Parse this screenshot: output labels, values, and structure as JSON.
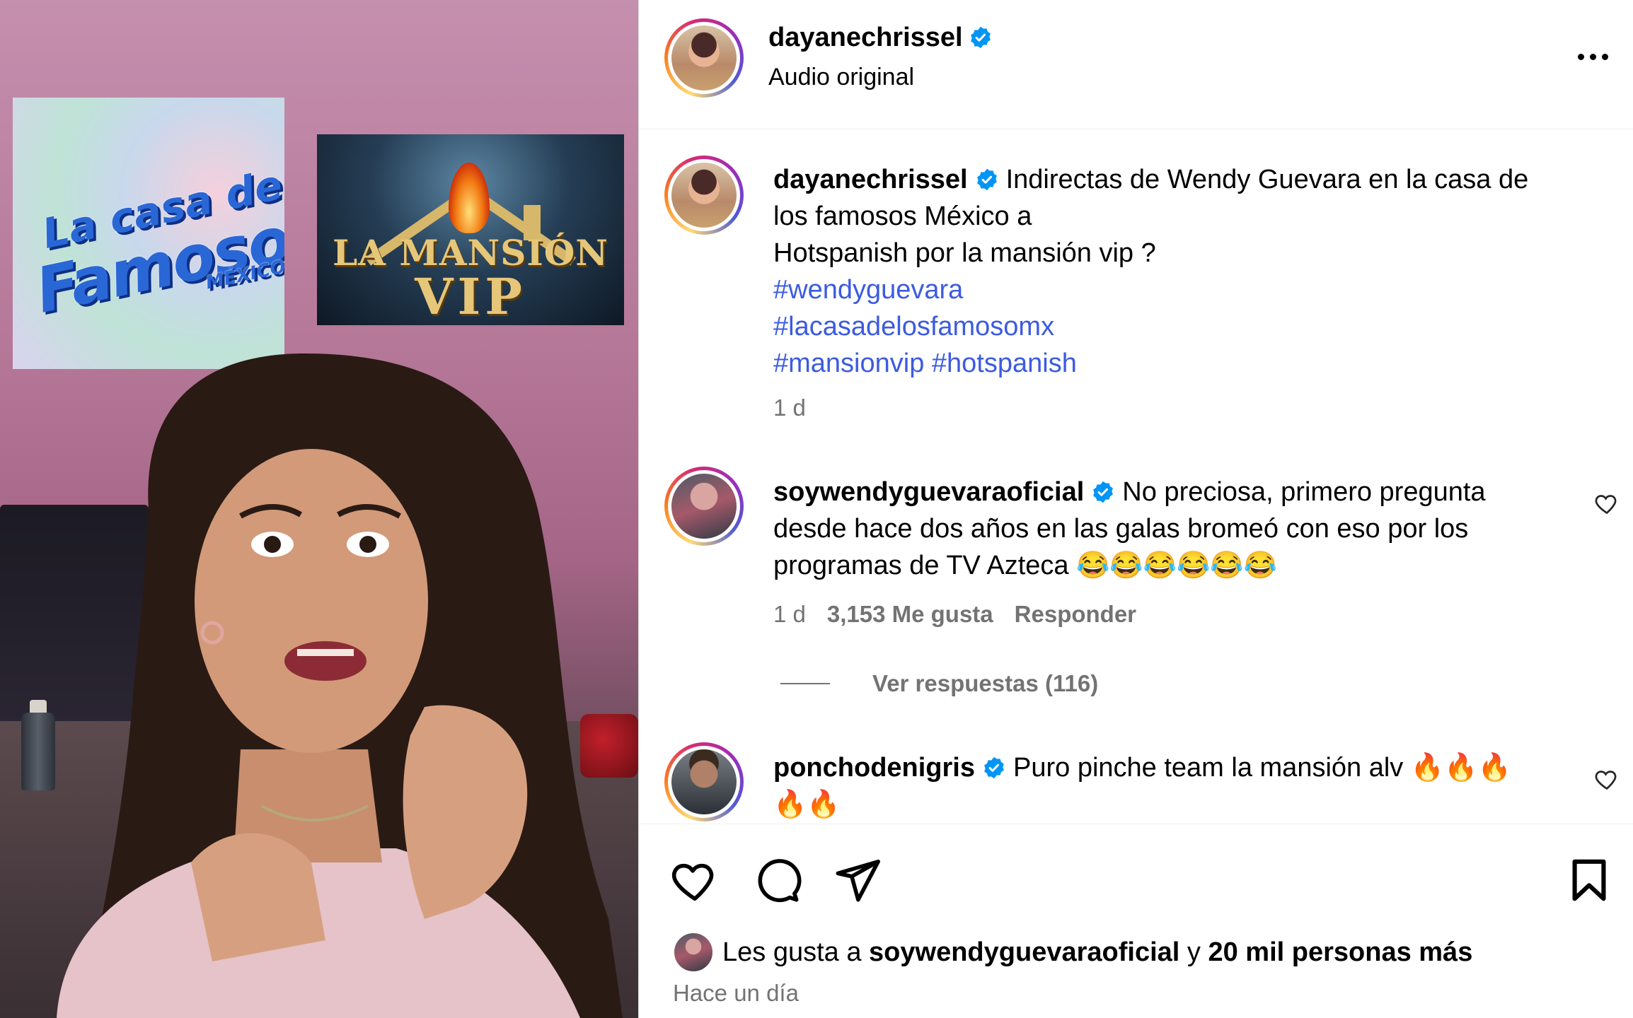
{
  "post": {
    "author": "dayanechrissel",
    "audio": "Audio original"
  },
  "caption": {
    "author": "dayanechrissel",
    "text_line1": "Indirectas de Wendy Guevara en la casa de",
    "text_line2": "los famosos México a",
    "text_line3": "Hotspanish por la mansión vip ?",
    "hashtags": [
      "#wendyguevara",
      "#lacasadelosfamosomx",
      "#mansionvip",
      "#hotspanish"
    ],
    "time": "1 d"
  },
  "comments": [
    {
      "author": "soywendyguevaraoficial",
      "line1": "No preciosa, primero pregunta",
      "line2": "desde hace dos años en las galas bromeó con eso por los",
      "line3": "programas de TV Azteca 😂😂😂😂😂😂",
      "time": "1 d",
      "likes": "3,153 Me gusta",
      "reply_label": "Responder",
      "view_replies": "Ver respuestas (116)"
    },
    {
      "author": "ponchodenigris",
      "line1": "Puro pinche team la mansión alv 🔥🔥🔥",
      "line2": "🔥🔥"
    }
  ],
  "likes_summary": {
    "prefix": "Les gusta a",
    "user": "soywendyguevaraoficial",
    "joiner": "y",
    "others": "20 mil personas más",
    "posted": "Hace un día"
  },
  "media": {
    "logo1_line1": "La casa de los",
    "logo1_line2": "Famosos",
    "logo1_line3": "MÉXICO",
    "logo2_line1": "LA MANSIÓN",
    "logo2_line2": "VIP"
  },
  "icons": {
    "verified": "verified-badge-icon",
    "more": "more-options-icon",
    "like": "heart-icon",
    "comment": "comment-icon",
    "share": "paper-plane-icon",
    "save": "bookmark-icon"
  },
  "colors": {
    "hashtag": "#3c5be0",
    "verified": "#0095f6",
    "muted": "#737373"
  }
}
